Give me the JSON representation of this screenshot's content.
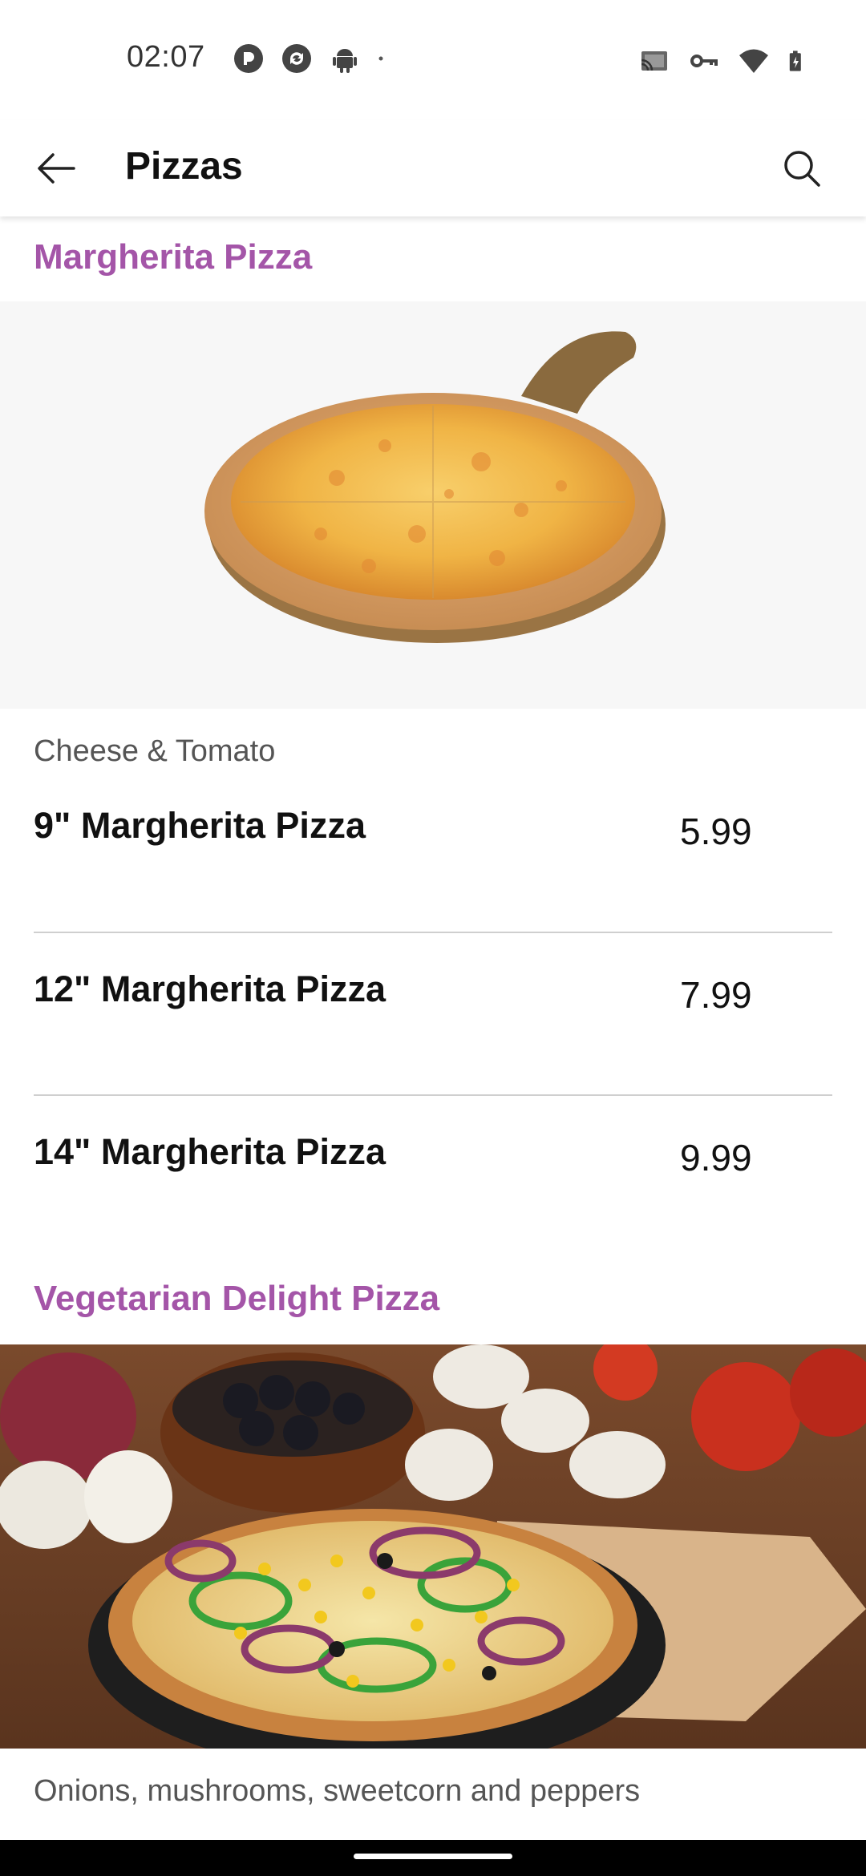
{
  "status_bar": {
    "time": "02:07",
    "left_icons": [
      "pocket-casts-icon",
      "sync-icon",
      "android-icon",
      "notification-dot-icon"
    ],
    "right_icons": [
      "cast-icon",
      "vpn-key-icon",
      "wifi-icon",
      "battery-charging-icon"
    ]
  },
  "app_bar": {
    "title": "Pizzas",
    "back_icon": "arrow-left-icon",
    "search_icon": "search-icon"
  },
  "sections": [
    {
      "title": "Margherita Pizza",
      "image": "margherita-pizza-image",
      "description": "Cheese & Tomato",
      "items": [
        {
          "name": "9\" Margherita Pizza",
          "price": "5.99"
        },
        {
          "name": "12\" Margherita Pizza",
          "price": "7.99"
        },
        {
          "name": "14\" Margherita Pizza",
          "price": "9.99"
        }
      ]
    },
    {
      "title": "Vegetarian Delight Pizza",
      "image": "vegetarian-pizza-image",
      "description": "Onions, mushrooms, sweetcorn and peppers"
    }
  ],
  "colors": {
    "section_title": "#a455a8",
    "text": "#111111",
    "subtitle": "#555555",
    "divider": "#cfcfcf"
  }
}
